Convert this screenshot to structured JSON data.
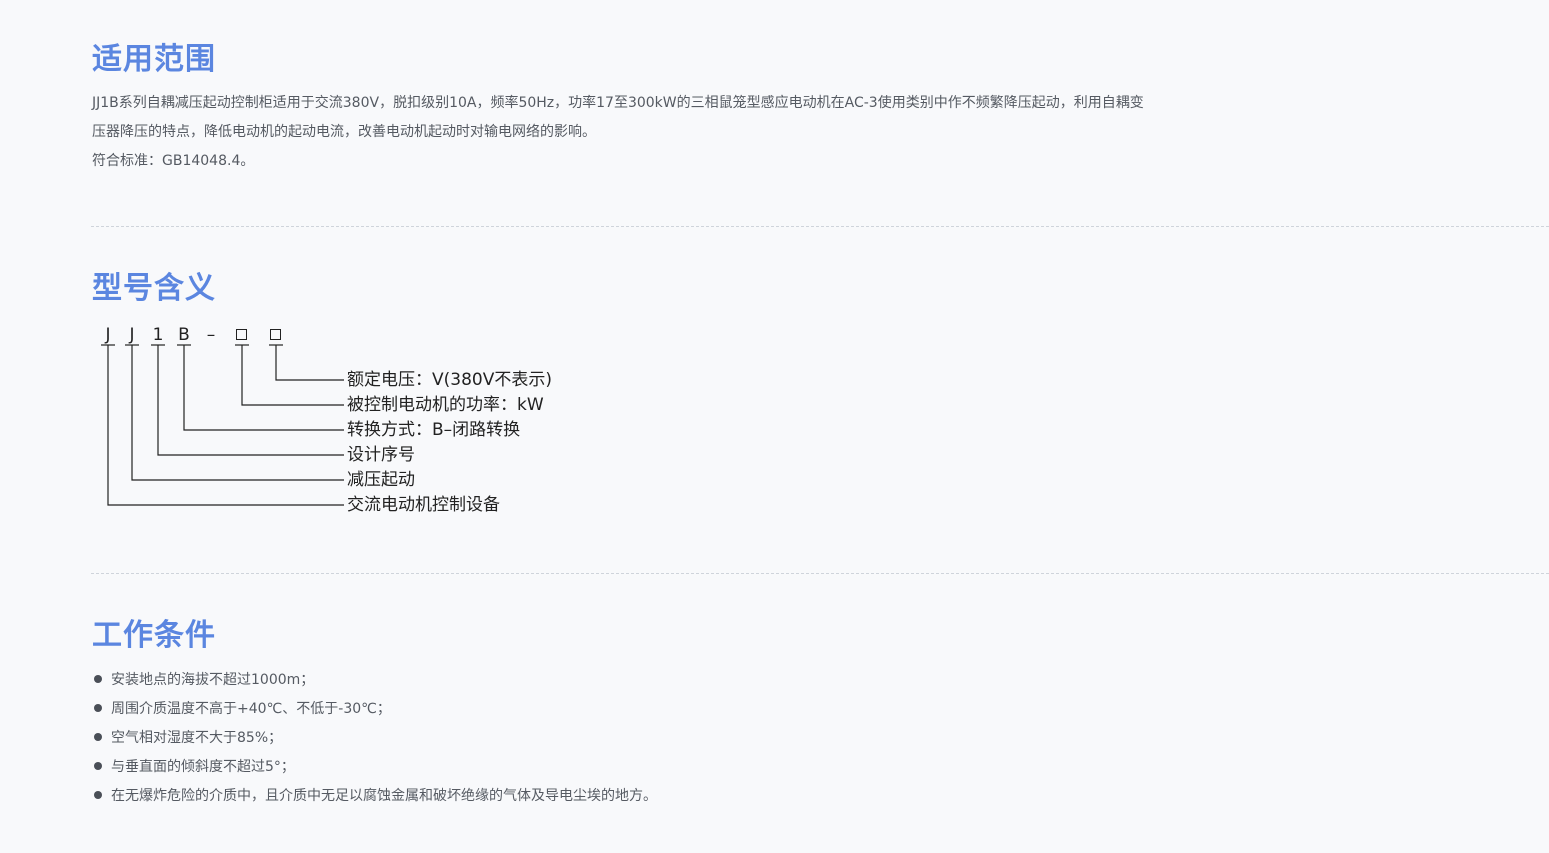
{
  "scope": {
    "title": "适用范围",
    "line1": "JJ1B系列自耦减压起动控制柜适用于交流380V，脱扣级别10A，频率50Hz，功率17至300kW的三相鼠笼型感应电动机在AC-3使用类别中作不频繁降压起动，利用自耦变",
    "line2": "压器降压的特点，降低电动机的起动电流，改善电动机起动时对输电网络的影响。",
    "line3": "符合标准：GB14048.4。"
  },
  "model": {
    "title": "型号含义",
    "code": [
      "J",
      "J",
      "1",
      "B",
      "–"
    ],
    "labels": [
      "额定电压：V(380V不表示)",
      "被控制电动机的功率：kW",
      "转换方式：B–闭路转换",
      "设计序号",
      "减压起动",
      "交流电动机控制设备"
    ]
  },
  "conditions": {
    "title": "工作条件",
    "items": [
      "安装地点的海拔不超过1000m；",
      "周围介质温度不高于+40℃、不低于-30℃；",
      "空气相对湿度不大于85%；",
      "与垂直面的倾斜度不超过5°；",
      "在无爆炸危险的介质中，且介质中无足以腐蚀金属和破坏绝缘的气体及导电尘埃的地方。"
    ]
  }
}
